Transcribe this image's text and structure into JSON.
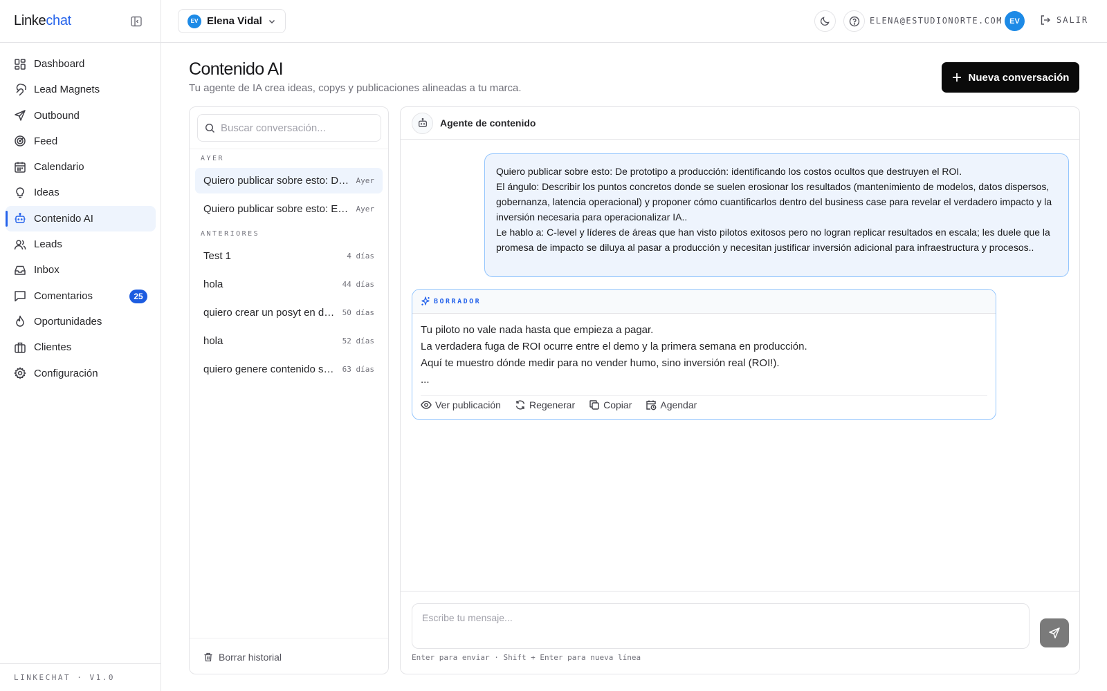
{
  "brand": {
    "part1": "Linke",
    "part2": "chat"
  },
  "sidebar": {
    "items": [
      {
        "label": "Dashboard",
        "icon": "dashboard-icon"
      },
      {
        "label": "Lead Magnets",
        "icon": "magnet-icon"
      },
      {
        "label": "Outbound",
        "icon": "send-icon"
      },
      {
        "label": "Feed",
        "icon": "radar-icon"
      },
      {
        "label": "Calendario",
        "icon": "calendar-icon"
      },
      {
        "label": "Ideas",
        "icon": "lightbulb-icon"
      },
      {
        "label": "Contenido AI",
        "icon": "bot-icon",
        "active": true
      },
      {
        "label": "Leads",
        "icon": "users-icon"
      },
      {
        "label": "Inbox",
        "icon": "inbox-icon"
      },
      {
        "label": "Comentarios",
        "icon": "comment-icon",
        "badge": "25"
      },
      {
        "label": "Oportunidades",
        "icon": "flame-icon"
      },
      {
        "label": "Clientes",
        "icon": "briefcase-icon"
      },
      {
        "label": "Configuración",
        "icon": "gear-icon"
      }
    ],
    "footer": "LINKECHAT · V1.0"
  },
  "topbar": {
    "account": {
      "initials": "EV",
      "name": "Elena Vidal"
    },
    "email": "ELENA@ESTUDIONORTE.COM",
    "user_initials": "EV",
    "logout_label": "SALIR"
  },
  "header": {
    "title": "Contenido AI",
    "subtitle": "Tu agente de IA crea ideas, copys y publicaciones alineadas a tu marca.",
    "new_button": "Nueva conversación"
  },
  "conversations": {
    "search_placeholder": "Buscar conversación...",
    "groups": [
      {
        "label": "AYER",
        "items": [
          {
            "title": "Quiero publicar sobre esto: De prototipo a producción",
            "time": "Ayer",
            "active": true
          },
          {
            "title": "Quiero publicar sobre esto: El ángulo",
            "time": "Ayer"
          }
        ]
      },
      {
        "label": "ANTERIORES",
        "items": [
          {
            "title": "Test 1",
            "time": "4 días"
          },
          {
            "title": "hola",
            "time": "44 días"
          },
          {
            "title": "quiero crear un posyt en donde",
            "time": "50 días"
          },
          {
            "title": "hola",
            "time": "52 días"
          },
          {
            "title": "quiero genere contenido sobre",
            "time": "63 días"
          }
        ]
      }
    ],
    "clear_label": "Borrar historial"
  },
  "chat": {
    "agent_name": "Agente de contenido",
    "user_message": [
      "Quiero publicar sobre esto: De prototipo a producción: identificando los costos ocultos que destruyen el ROI.",
      "El ángulo: Describir los puntos concretos donde se suelen erosionar los resultados (mantenimiento de modelos, datos dispersos, gobernanza, latencia operacional) y proponer cómo cuantificarlos dentro del business case para revelar el verdadero impacto y la inversión necesaria para operacionalizar IA..",
      "Le hablo a: C-level y líderes de áreas que han visto pilotos exitosos pero no logran replicar resultados en escala; les duele que la promesa de impacto se diluya al pasar a producción y necesitan justificar inversión adicional para infraestructura y procesos.."
    ],
    "draft": {
      "label": "BORRADOR",
      "lines": [
        "Tu piloto no vale nada hasta que empieza a pagar.",
        "La verdadera fuga de ROI ocurre entre el demo y la primera semana en producción.",
        "Aquí te muestro dónde medir para no vender humo, sino inversión real (ROI!).",
        "..."
      ],
      "actions": {
        "view": "Ver publicación",
        "regenerate": "Regenerar",
        "copy": "Copiar",
        "schedule": "Agendar"
      }
    },
    "composer_placeholder": "Escribe tu mensaje...",
    "composer_hint": "Enter para enviar · Shift + Enter para nueva línea"
  },
  "colors": {
    "accent": "#2563eb",
    "primary_button": "#0a0a0a",
    "active_bg": "#eef4fd",
    "badge": "#1d5ce0"
  }
}
